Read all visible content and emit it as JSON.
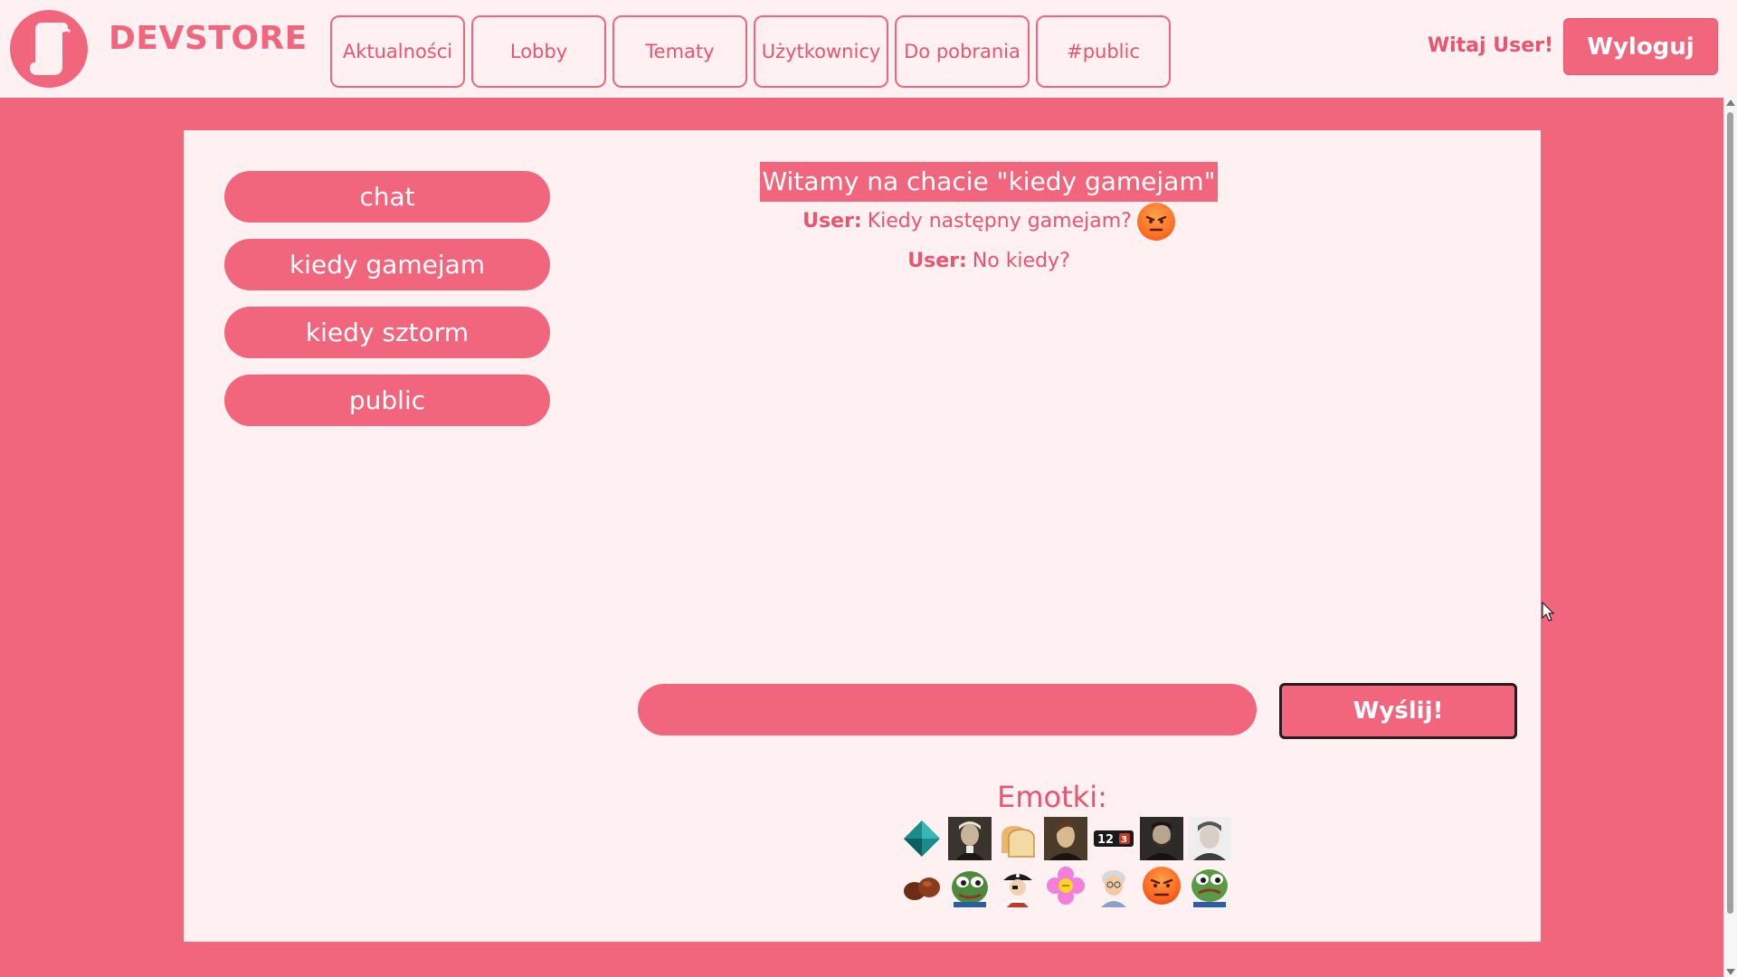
{
  "colors": {
    "brand": "#f2667d",
    "brand_dark": "#e9546f",
    "surface": "#fff0f2",
    "text_on_brand": "#ffffff"
  },
  "header": {
    "logo_icon": "scroll-logo-icon",
    "brand": "DEVSTORE",
    "nav": [
      {
        "label": "Aktualności"
      },
      {
        "label": "Lobby"
      },
      {
        "label": "Tematy"
      },
      {
        "label": "Użytkownicy"
      },
      {
        "label": "Do pobrania"
      },
      {
        "label": "#public"
      }
    ],
    "greeting": "Witaj User!",
    "logout_label": "Wyloguj"
  },
  "rooms": [
    {
      "label": "chat"
    },
    {
      "label": "kiedy gamejam"
    },
    {
      "label": "kiedy sztorm"
    },
    {
      "label": "public"
    }
  ],
  "chat": {
    "title": "Witamy na chacie \"kiedy gamejam\"",
    "messages": [
      {
        "author": "User:",
        "text": "Kiedy następny gamejam?",
        "emoji": "angry-face-icon"
      },
      {
        "author": "User:",
        "text": "No kiedy?"
      }
    ],
    "input_value": "",
    "send_label": "Wyślij!"
  },
  "emotes": {
    "label": "Emotki:",
    "items": [
      {
        "icon": "diamond-icon"
      },
      {
        "icon": "portrait-1-icon"
      },
      {
        "icon": "bread-icon"
      },
      {
        "icon": "portrait-2-icon"
      },
      {
        "icon": "numbers-icon"
      },
      {
        "icon": "portrait-3-icon"
      },
      {
        "icon": "portrait-4-icon"
      },
      {
        "icon": "chestnuts-icon"
      },
      {
        "icon": "pepe-frog-icon"
      },
      {
        "icon": "pirate-icon"
      },
      {
        "icon": "pink-flower-icon"
      },
      {
        "icon": "grandma-icon"
      },
      {
        "icon": "angry-face-icon"
      },
      {
        "icon": "pepe-frog-2-icon"
      }
    ]
  }
}
